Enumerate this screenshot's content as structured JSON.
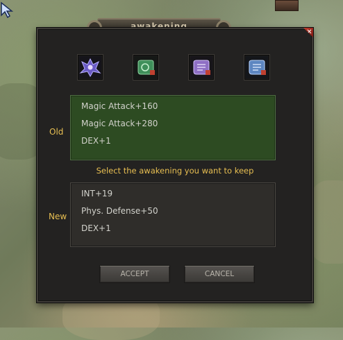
{
  "window": {
    "title": "awakening",
    "close_glyph": "✕"
  },
  "items": [
    {
      "icon": "winged-crest-icon",
      "color": "#6a5bc4"
    },
    {
      "icon": "green-scroll-icon",
      "color": "#3f8f5a"
    },
    {
      "icon": "purple-scroll-icon",
      "color": "#8e6fc4"
    },
    {
      "icon": "blue-scroll-icon",
      "color": "#5d86c0"
    }
  ],
  "old": {
    "label": "Old",
    "stats": [
      "Magic Attack+160",
      "Magic Attack+280",
      "DEX+1"
    ]
  },
  "hint": "Select the awakening you want to keep",
  "new": {
    "label": "New",
    "stats": [
      "INT+19",
      "Phys. Defense+50",
      "DEX+1"
    ]
  },
  "buttons": {
    "accept": "ACCEPT",
    "cancel": "CANCEL"
  },
  "colors": {
    "label_gold": "#e8bf52",
    "old_panel": "#2d4b22",
    "new_panel": "#2f2d2a"
  }
}
